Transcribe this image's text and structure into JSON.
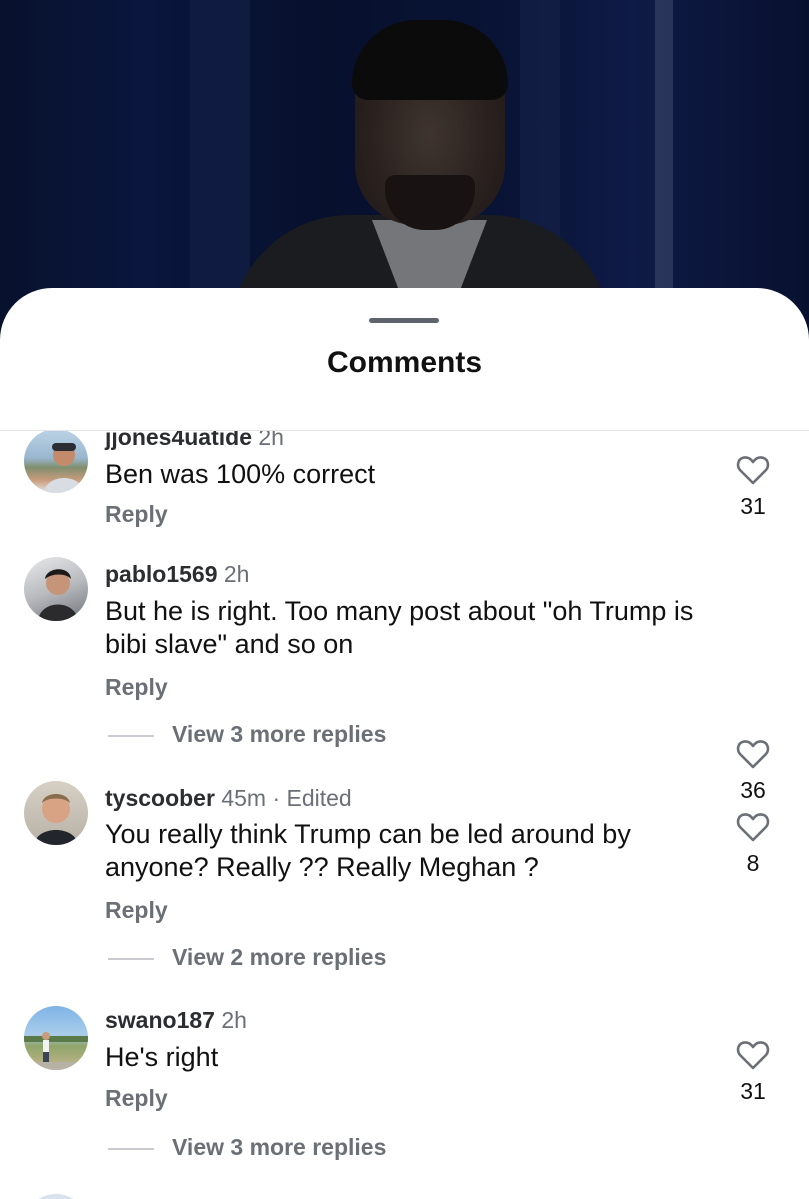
{
  "sheet": {
    "title": "Comments"
  },
  "comments": [
    {
      "username": "jjones4uatide",
      "time": "2h",
      "text": "Ben was 100% correct",
      "reply_label": "Reply",
      "likes": "31"
    },
    {
      "username": "pablo1569",
      "time": "2h",
      "text": "But he is right. Too many post about \"oh Trump is bibi slave\" and so on",
      "reply_label": "Reply",
      "likes": "36",
      "view_more": "View 3 more replies"
    },
    {
      "username": "tyscoober",
      "time": "45m · Edited",
      "text": "You really think Trump can be led around by anyone? Really ?? Really Meghan ?",
      "reply_label": "Reply",
      "likes": "8",
      "view_more": "View 2 more replies"
    },
    {
      "username": "swano187",
      "time": "2h",
      "text": "He's right",
      "reply_label": "Reply",
      "likes": "31",
      "view_more": "View 3 more replies"
    }
  ],
  "icons": {
    "like": "heart-outline-icon"
  },
  "colors": {
    "meta_gray": "#6b6f76",
    "text": "#111111"
  }
}
